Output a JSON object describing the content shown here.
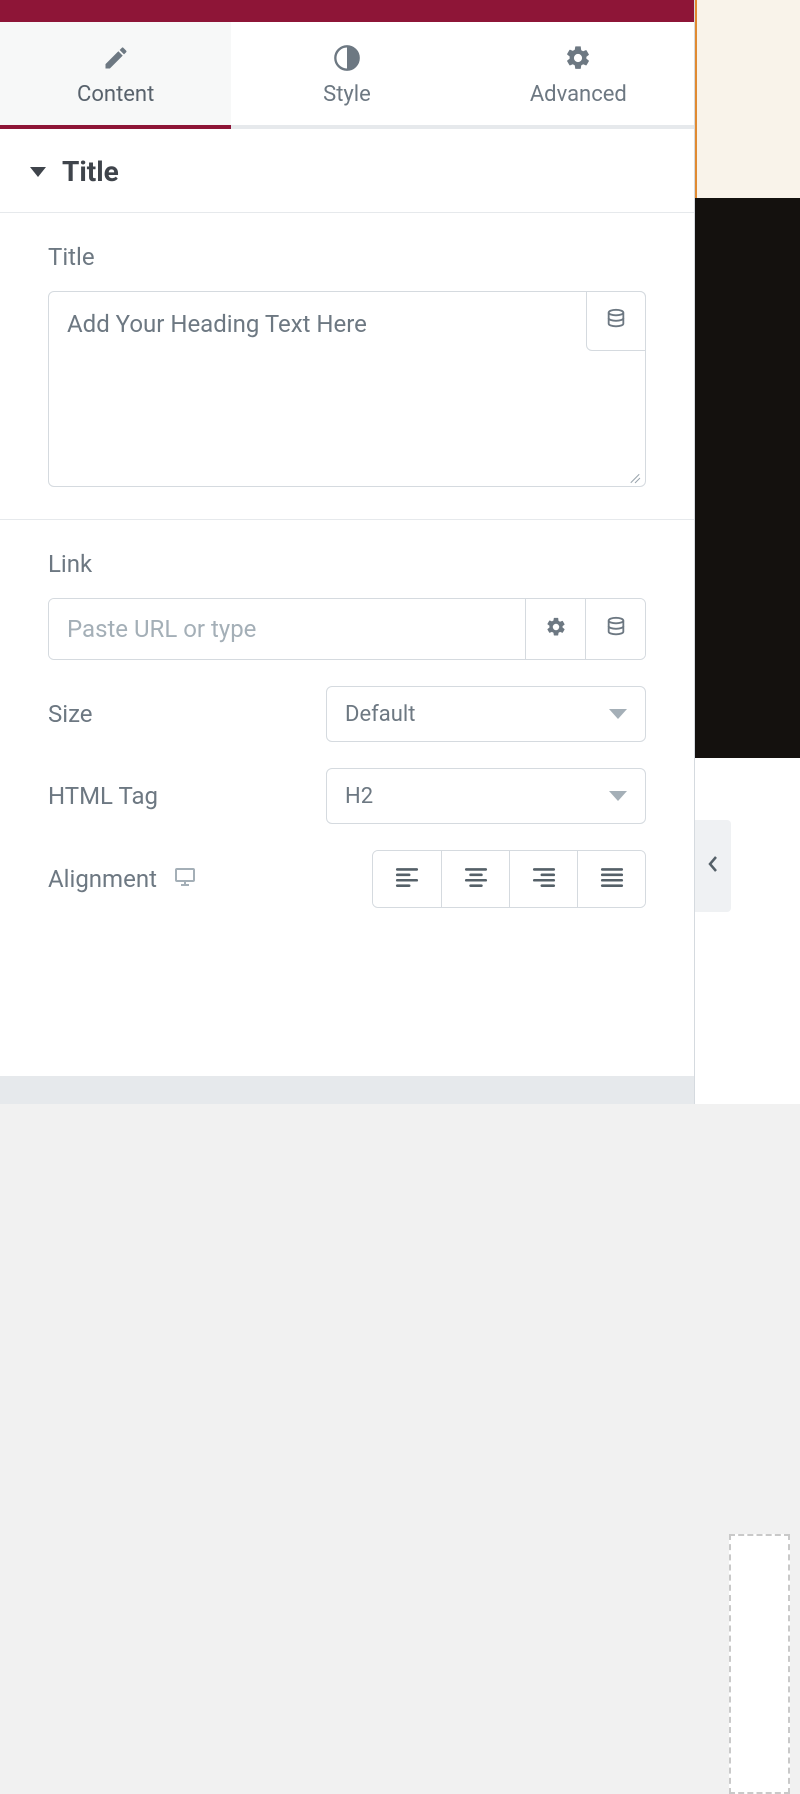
{
  "tabs": {
    "content": "Content",
    "style": "Style",
    "advanced": "Advanced"
  },
  "section": {
    "title": "Title"
  },
  "fields": {
    "title": {
      "label": "Title",
      "value": "Add Your Heading Text Here"
    },
    "link": {
      "label": "Link",
      "placeholder": "Paste URL or type",
      "value": ""
    },
    "size": {
      "label": "Size",
      "value": "Default"
    },
    "html_tag": {
      "label": "HTML Tag",
      "value": "H2"
    },
    "alignment": {
      "label": "Alignment"
    }
  }
}
